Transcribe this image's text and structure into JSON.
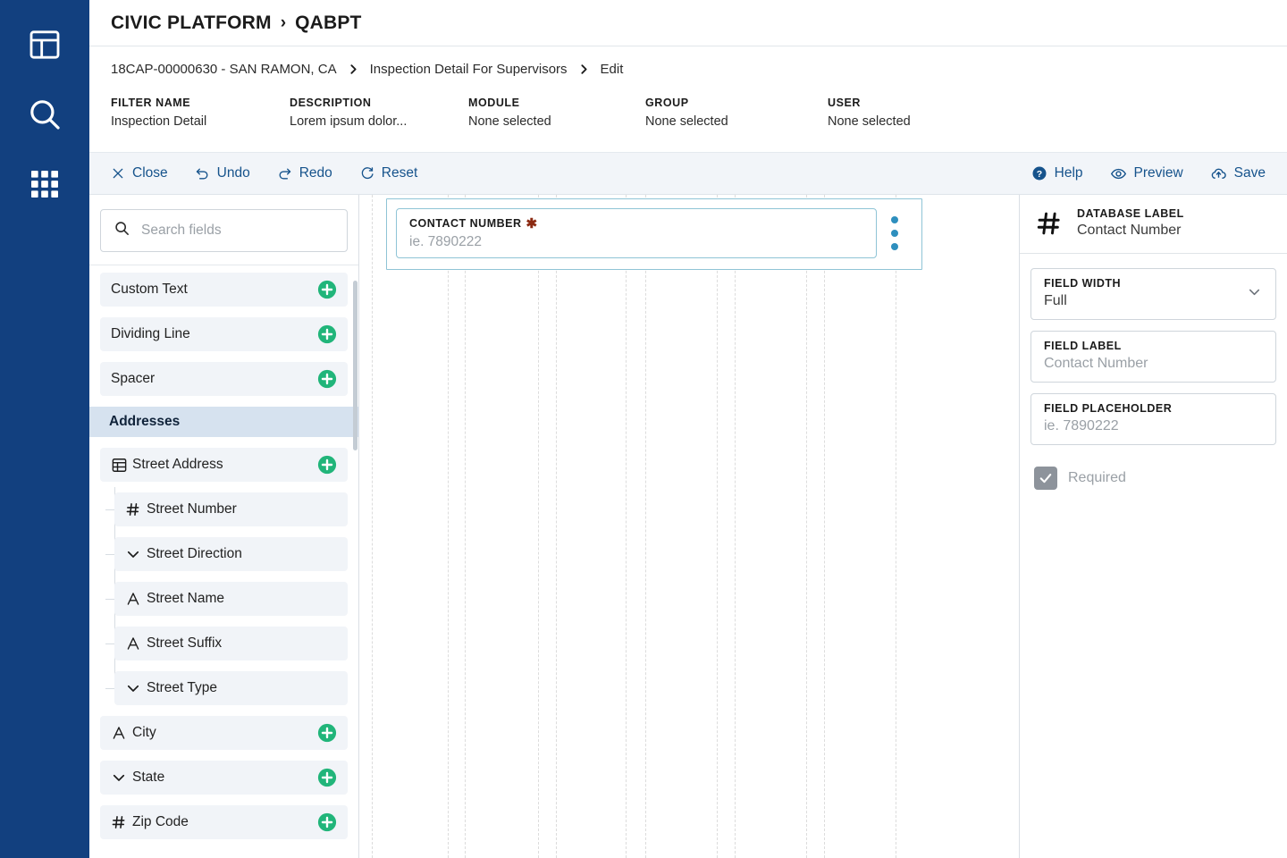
{
  "rail": {
    "items": [
      {
        "name": "dashboard-icon",
        "label": "Dashboard"
      },
      {
        "name": "search-icon",
        "label": "Search"
      },
      {
        "name": "apps-grid-icon",
        "label": "Apps"
      }
    ]
  },
  "header": {
    "app_name": "CIVIC PLATFORM",
    "separator": "›",
    "tenant": "QABPT"
  },
  "breadcrumb": {
    "items": [
      "18CAP-00000630 - SAN RAMON, CA",
      "Inspection Detail For Supervisors",
      "Edit"
    ],
    "separator": "›"
  },
  "meta": {
    "columns": [
      {
        "label": "FILTER NAME",
        "value": "Inspection Detail"
      },
      {
        "label": "DESCRIPTION",
        "value": "Lorem ipsum dolor..."
      },
      {
        "label": "MODULE",
        "value": "None selected"
      },
      {
        "label": "GROUP",
        "value": "None selected"
      },
      {
        "label": "USER",
        "value": "None selected"
      }
    ]
  },
  "toolbar": {
    "left": [
      {
        "label": "Close",
        "icon": "close-icon"
      },
      {
        "label": "Undo",
        "icon": "undo-icon"
      },
      {
        "label": "Redo",
        "icon": "redo-icon"
      },
      {
        "label": "Reset",
        "icon": "reset-icon"
      }
    ],
    "right": [
      {
        "label": "Help",
        "icon": "help-icon"
      },
      {
        "label": "Preview",
        "icon": "eye-icon"
      },
      {
        "label": "Save",
        "icon": "cloud-upload-icon"
      }
    ],
    "accent_color": "#16538c",
    "background": "#f2f5f9"
  },
  "sidebar": {
    "search": {
      "placeholder": "Search fields",
      "value": "",
      "icon": "search-icon"
    },
    "basic_items": [
      {
        "label": "Custom Text",
        "icon": "none",
        "add": "plus-icon"
      },
      {
        "label": "Dividing Line",
        "icon": "none",
        "add": "plus-icon"
      },
      {
        "label": "Spacer",
        "icon": "none",
        "add": "plus-icon"
      }
    ],
    "group": {
      "label": "Addresses"
    },
    "group_items": [
      {
        "label": "Street Address",
        "icon": "table-icon",
        "add": "plus-icon",
        "children": [
          {
            "label": "Street Number",
            "icon": "number-icon"
          },
          {
            "label": "Street Direction",
            "icon": "dropdown-icon"
          },
          {
            "label": "Street Name",
            "icon": "text-icon"
          },
          {
            "label": "Street Suffix",
            "icon": "text-icon"
          },
          {
            "label": "Street Type",
            "icon": "dropdown-icon"
          }
        ]
      },
      {
        "label": "City",
        "icon": "text-icon",
        "add": "plus-icon"
      },
      {
        "label": "State",
        "icon": "dropdown-icon",
        "add": "plus-icon"
      },
      {
        "label": "Zip Code",
        "icon": "number-icon",
        "add": "plus-icon"
      }
    ],
    "add_button_color": "#21b57a"
  },
  "canvas": {
    "field_card": {
      "label": "CONTACT NUMBER",
      "required_marker": "✱",
      "placeholder": "ie. 7890222",
      "value": "",
      "menu_icon": "more-vertical-icon",
      "border_color": "#8fc4d6",
      "menu_color": "#2e8fbe"
    },
    "guide_positions": [
      14,
      99,
      118,
      200,
      220,
      298,
      320,
      400,
      420,
      500,
      520,
      600
    ]
  },
  "properties": {
    "header": {
      "icon": "number-icon",
      "label": "DATABASE LABEL",
      "value": "Contact Number"
    },
    "fields": [
      {
        "label": "FIELD WIDTH",
        "value": "Full",
        "type": "select",
        "muted": false,
        "icon": "chevron-down-icon"
      },
      {
        "label": "FIELD LABEL",
        "value": "Contact Number",
        "type": "text",
        "muted": true
      },
      {
        "label": "FIELD PLACEHOLDER",
        "value": "ie. 7890222",
        "type": "text",
        "muted": true
      }
    ],
    "checkbox": {
      "label": "Required",
      "checked": true,
      "disabled": true,
      "icon": "check-icon"
    }
  }
}
